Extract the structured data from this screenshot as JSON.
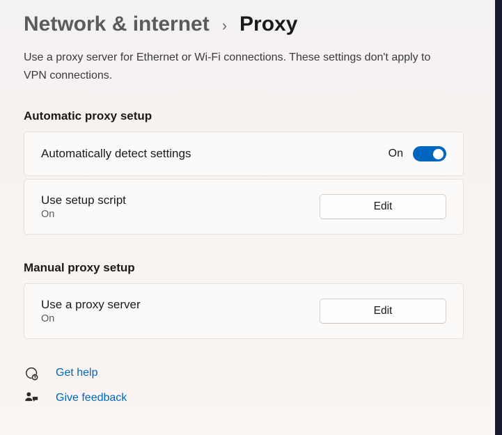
{
  "breadcrumb": {
    "parent": "Network & internet",
    "separator": "›",
    "current": "Proxy"
  },
  "description": "Use a proxy server for Ethernet or Wi-Fi connections. These settings don't apply to VPN connections.",
  "sections": {
    "automatic": {
      "header": "Automatic proxy setup",
      "auto_detect": {
        "title": "Automatically detect settings",
        "state_label": "On",
        "enabled": true
      },
      "setup_script": {
        "title": "Use setup script",
        "state": "On",
        "button": "Edit"
      }
    },
    "manual": {
      "header": "Manual proxy setup",
      "proxy_server": {
        "title": "Use a proxy server",
        "state": "On",
        "button": "Edit"
      }
    }
  },
  "footer": {
    "help": "Get help",
    "feedback": "Give feedback"
  }
}
